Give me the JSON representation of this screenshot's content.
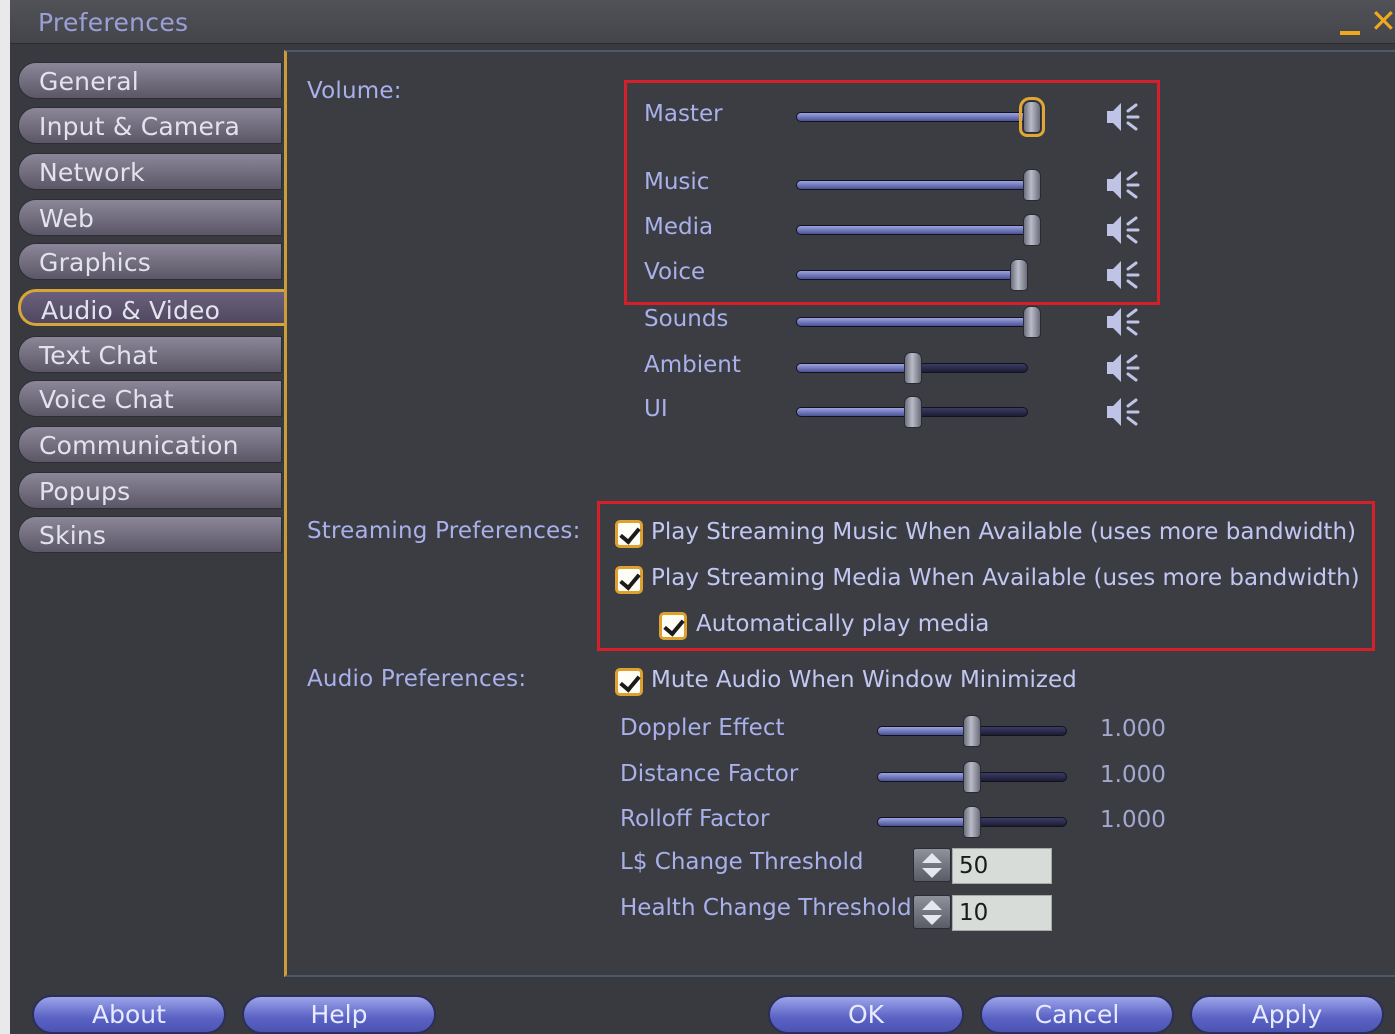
{
  "window": {
    "title": "Preferences"
  },
  "sidebar": {
    "items": [
      {
        "label": "General",
        "active": false
      },
      {
        "label": "Input & Camera",
        "active": false
      },
      {
        "label": "Network",
        "active": false
      },
      {
        "label": "Web",
        "active": false
      },
      {
        "label": "Graphics",
        "active": false
      },
      {
        "label": "Audio & Video",
        "active": true
      },
      {
        "label": "Text Chat",
        "active": false
      },
      {
        "label": "Voice Chat",
        "active": false
      },
      {
        "label": "Communication",
        "active": false
      },
      {
        "label": "Popups",
        "active": false
      },
      {
        "label": "Skins",
        "active": false
      }
    ]
  },
  "volume": {
    "label": "Volume:",
    "sliders": [
      {
        "label": "Master",
        "level": 1.0
      },
      {
        "label": "Music",
        "level": 1.0
      },
      {
        "label": "Media",
        "level": 1.0
      },
      {
        "label": "Voice",
        "level": 0.95
      },
      {
        "label": "Sounds",
        "level": 1.0
      },
      {
        "label": "Ambient",
        "level": 0.5
      },
      {
        "label": "UI",
        "level": 0.5
      }
    ]
  },
  "streaming": {
    "label": "Streaming Preferences:",
    "options": [
      {
        "label": "Play Streaming Music When Available (uses more bandwidth)",
        "checked": true
      },
      {
        "label": "Play Streaming Media When Available (uses more bandwidth)",
        "checked": true
      },
      {
        "label": "Automatically play media",
        "checked": true
      }
    ]
  },
  "audio": {
    "label": "Audio Preferences:",
    "mute_minimized": {
      "label": "Mute Audio When Window Minimized",
      "checked": true
    },
    "factors": [
      {
        "label": "Doppler Effect",
        "value": "1.000",
        "level": 0.5
      },
      {
        "label": "Distance Factor",
        "value": "1.000",
        "level": 0.5
      },
      {
        "label": "Rolloff Factor",
        "value": "1.000",
        "level": 0.5
      }
    ],
    "thresholds": [
      {
        "label": "L$ Change Threshold",
        "value": "50"
      },
      {
        "label": "Health Change Threshold",
        "value": "10"
      }
    ]
  },
  "buttons": {
    "about": "About",
    "help": "Help",
    "ok": "OK",
    "cancel": "Cancel",
    "apply": "Apply"
  },
  "colors": {
    "accent": "#e1a736",
    "highlight_box": "#d5202b",
    "button": "#5a62c4"
  }
}
